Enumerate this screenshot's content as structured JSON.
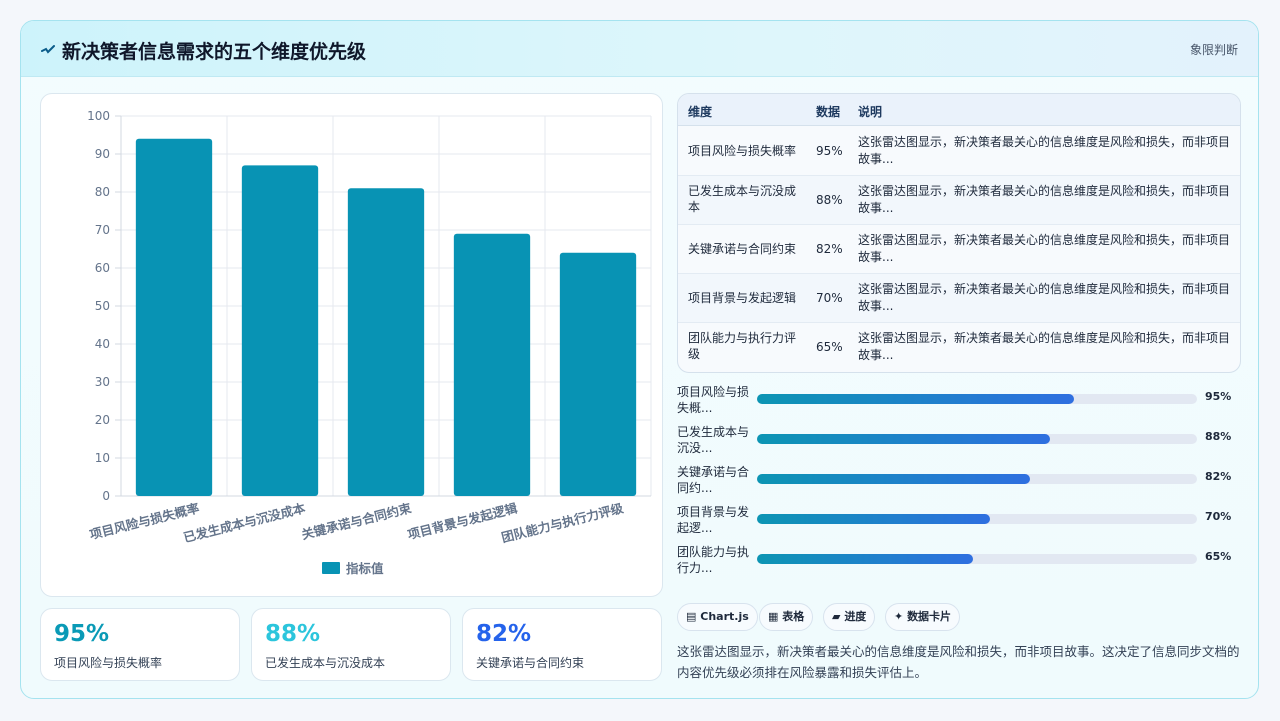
{
  "header": {
    "title": "新决策者信息需求的五个维度优先级",
    "tag": "象限判断"
  },
  "colors": {
    "bar": "#0893b4",
    "accent_teal": "#0a9ab6",
    "accent_cyan": "#2cc5dc",
    "accent_blue": "#2563eb"
  },
  "chart_data": {
    "type": "bar",
    "categories": [
      "项目风险与损失概率",
      "已发生成本与沉没成本",
      "关键承诺与合同约束",
      "项目背景与发起逻辑",
      "团队能力与执行力评级"
    ],
    "series": [
      {
        "name": "指标值",
        "values": [
          94,
          87,
          81,
          69,
          64
        ]
      }
    ],
    "ylim": [
      0,
      100
    ],
    "yticks": [
      "0",
      "10",
      "20",
      "30",
      "40",
      "50",
      "60",
      "70",
      "80",
      "90",
      "100"
    ],
    "grid": true,
    "legend_position": "bottom"
  },
  "table": {
    "headers": {
      "dim": "维度",
      "data": "数据",
      "desc": "说明"
    },
    "rows": [
      {
        "dim": "项目风险与损失概率",
        "data": "95%",
        "desc": "这张雷达图显示，新决策者最关心的信息维度是风险和损失，而非项目故事..."
      },
      {
        "dim": "已发生成本与沉没成本",
        "data": "88%",
        "desc": "这张雷达图显示，新决策者最关心的信息维度是风险和损失，而非项目故事..."
      },
      {
        "dim": "关键承诺与合同约束",
        "data": "82%",
        "desc": "这张雷达图显示，新决策者最关心的信息维度是风险和损失，而非项目故事..."
      },
      {
        "dim": "项目背景与发起逻辑",
        "data": "70%",
        "desc": "这张雷达图显示，新决策者最关心的信息维度是风险和损失，而非项目故事..."
      },
      {
        "dim": "团队能力与执行力评级",
        "data": "65%",
        "desc": "这张雷达图显示，新决策者最关心的信息维度是风险和损失，而非项目故事..."
      }
    ]
  },
  "progress": [
    {
      "label": "项目风险与损失概...",
      "value_text": "95%",
      "fill": 0.72
    },
    {
      "label": "已发生成本与沉没...",
      "value_text": "88%",
      "fill": 0.665
    },
    {
      "label": "关键承诺与合同约...",
      "value_text": "82%",
      "fill": 0.62
    },
    {
      "label": "项目背景与发起逻...",
      "value_text": "70%",
      "fill": 0.53
    },
    {
      "label": "团队能力与执行力...",
      "value_text": "65%",
      "fill": 0.49
    }
  ],
  "stats": [
    {
      "value": "95%",
      "label": "项目风险与损失概率",
      "color": "#0a9ab6"
    },
    {
      "value": "88%",
      "label": "已发生成本与沉没成本",
      "color": "#2cc5dc"
    },
    {
      "value": "82%",
      "label": "关键承诺与合同约束",
      "color": "#2563eb"
    }
  ],
  "chips": [
    {
      "icon": "▤",
      "label": "Chart.js"
    },
    {
      "icon": "▦",
      "label": "表格"
    },
    {
      "icon": "▰",
      "label": "进度"
    },
    {
      "icon": "✦",
      "label": "数据卡片"
    }
  ],
  "note": "这张雷达图显示，新决策者最关心的信息维度是风险和损失，而非项目故事。这决定了信息同步文档的内容优先级必须排在风险暴露和损失评估上。"
}
